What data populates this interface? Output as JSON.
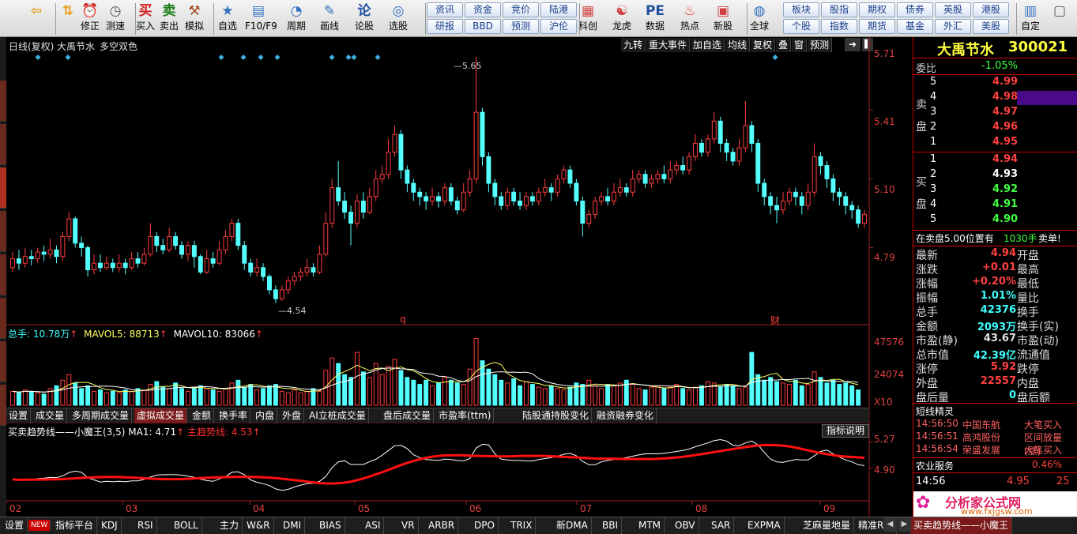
{
  "toolbar": {
    "left": [
      {
        "icon": "back-arrow-icon",
        "label": "",
        "x": 45
      },
      {
        "icon": "up-down-arrow-icon",
        "label": "",
        "x": 85
      },
      {
        "icon": "alarm-icon",
        "label": "修正",
        "x": 113
      },
      {
        "icon": "clock-icon",
        "label": "测速",
        "x": 145
      },
      {
        "icon": "buy-icon",
        "label": "买入",
        "x": 183
      },
      {
        "icon": "sell-icon",
        "label": "卖出",
        "x": 213
      },
      {
        "icon": "hammer-icon",
        "label": "模拟",
        "x": 245
      },
      {
        "icon": "star-icon",
        "label": "自选",
        "x": 287
      },
      {
        "icon": "f10-icon",
        "label": "F10/F9",
        "x": 326
      },
      {
        "icon": "period-icon",
        "label": "周期",
        "x": 374
      },
      {
        "icon": "pen-icon",
        "label": "画线",
        "x": 416
      },
      {
        "icon": "lungu-icon",
        "label": "论股",
        "x": 460
      },
      {
        "icon": "select-stock-icon",
        "label": "选股",
        "x": 503
      }
    ],
    "grid_top": [
      "资讯",
      "资金",
      "竞价",
      "陆港"
    ],
    "grid_bottom": [
      "研报",
      "BBD",
      "预测",
      "沪伦"
    ],
    "mid": [
      {
        "icon": "chart-icon",
        "label": "科创",
        "x": 743
      },
      {
        "icon": "dragon-icon",
        "label": "龙虎",
        "x": 786
      },
      {
        "icon": "pe-icon",
        "label": "数据",
        "x": 828
      },
      {
        "icon": "hot-icon",
        "label": "热点",
        "x": 872
      },
      {
        "icon": "newstock-icon",
        "label": "新股",
        "x": 914
      },
      {
        "icon": "globe-icon",
        "label": "全球",
        "x": 960
      }
    ],
    "grid2_top": [
      "板块",
      "股指",
      "期权",
      "债券",
      "英股",
      "港股"
    ],
    "grid2_bottom": [
      "个股",
      "指数",
      "期货",
      "基金",
      "外汇",
      "美股"
    ],
    "right": [
      {
        "icon": "custom-icon",
        "label": "自定",
        "x": 1303
      },
      {
        "icon": "window-icon",
        "label": "",
        "x": 1340
      }
    ]
  },
  "header": {
    "title": "日线(复权)",
    "stock": "大禹节水",
    "indicator_name": "多空双色",
    "buttons": [
      "九转",
      "重大事件",
      "加自选",
      "均线",
      "复权",
      "叠",
      "窗",
      "预测"
    ]
  },
  "axis": {
    "price_ticks": [
      "5.71",
      "5.41",
      "5.10",
      "4.79"
    ],
    "high_label": "5.65",
    "low_label": "4.54",
    "vol_ticks": [
      "47576",
      "24074",
      "X10"
    ],
    "ind_ticks": [
      "5.27",
      "4.90"
    ],
    "x_labels": [
      "02",
      "03",
      "04",
      "05",
      "06",
      "07",
      "08",
      "09"
    ],
    "q_marker": "q",
    "cai_marker": "财"
  },
  "volume": {
    "label": "总手:",
    "value": "10.78万",
    "arrow": "↑",
    "mavol5_label": "MAVOL5:",
    "mavol5": "88713",
    "mavol10_label": "MAVOL10:",
    "mavol10": "83066"
  },
  "vol_tabs": [
    "设置",
    "成交量",
    "多周期成交量",
    "虚拟成交量",
    "金额",
    "换手率",
    "内盘",
    "外盘",
    "AI立桩成交量",
    "盘后成交量",
    "市盈率(ttm)",
    "陆股通持股变化",
    "融资融券变化"
  ],
  "vol_tab_active": "虚拟成交量",
  "indicator": {
    "name": "买卖趋势线——小魔王(3,5)",
    "ma1_label": "MA1:",
    "ma1": "4.71",
    "arrow": "↑",
    "main_label": "主趋势线:",
    "main": "4.53",
    "help": "指标说明"
  },
  "bottom_tabs": [
    "设置",
    "NEW",
    "指标平台",
    "KDJ",
    "RSI",
    "BOLL",
    "主力",
    "W&R",
    "DMI",
    "BIAS",
    "ASI",
    "VR",
    "ARBR",
    "DPO",
    "TRIX",
    "新DMA",
    "BBI",
    "MTM",
    "OBV",
    "SAR",
    "EXPMA",
    "芝麻量地量",
    "精准RSI",
    "买卖趋势线——小魔王"
  ],
  "quote": {
    "name": "大禹节水",
    "code": "300021",
    "weibi_label": "委比",
    "weibi": "-1.05%",
    "sell_label": "卖盘",
    "buy_label": "买盘",
    "asks": [
      {
        "lvl": "5",
        "price": "4.99",
        "vol": ""
      },
      {
        "lvl": "4",
        "price": "4.98",
        "vol": ""
      },
      {
        "lvl": "3",
        "price": "4.97",
        "vol": ""
      },
      {
        "lvl": "2",
        "price": "4.96",
        "vol": ""
      },
      {
        "lvl": "1",
        "price": "4.95",
        "vol": ""
      }
    ],
    "bids": [
      {
        "lvl": "1",
        "price": "4.94",
        "vol": ""
      },
      {
        "lvl": "2",
        "price": "4.93",
        "vol": ""
      },
      {
        "lvl": "3",
        "price": "4.92",
        "vol": ""
      },
      {
        "lvl": "4",
        "price": "4.91",
        "vol": ""
      },
      {
        "lvl": "5",
        "price": "4.90",
        "vol": ""
      }
    ],
    "note_left": "在卖盘5.00位置有",
    "note_vol": "1030手",
    "note_right": "卖单!",
    "stats": [
      {
        "l": "最新",
        "v": "4.94",
        "r": "开盘",
        "c": "#ff4040"
      },
      {
        "l": "涨跌",
        "v": "+0.01",
        "r": "最高",
        "c": "#ff4040"
      },
      {
        "l": "涨幅",
        "v": "+0.20%",
        "r": "最低",
        "c": "#ff4040"
      },
      {
        "l": "振幅",
        "v": "1.01%",
        "r": "量比",
        "c": "#40ffff"
      },
      {
        "l": "总手",
        "v": "42376",
        "r": "换手",
        "c": "#40ffff"
      },
      {
        "l": "金额",
        "v": "2093万",
        "r": "换手(实)",
        "c": "#40ffff"
      },
      {
        "l": "市盈(静)",
        "v": "43.67",
        "r": "市盈(动)",
        "c": "#e0e0e0"
      },
      {
        "l": "总市值",
        "v": "42.39亿",
        "r": "流通值",
        "c": "#40ffff"
      },
      {
        "l": "涨停",
        "v": "5.92",
        "r": "跌停",
        "c": "#ff4040"
      },
      {
        "l": "外盘",
        "v": "22557",
        "r": "内盘",
        "c": "#ff4040"
      },
      {
        "l": "盘后量",
        "v": "0",
        "r": "盘后额",
        "c": "#40ffff"
      }
    ],
    "jingling_title": "短线精灵",
    "jingling": [
      {
        "t": "14:56:50",
        "name": "中国东航",
        "act": "大笔买入"
      },
      {
        "t": "14:56:51",
        "name": "高鸿股份",
        "act": "区间放量(涨)"
      },
      {
        "t": "14:56:54",
        "name": "荣盛发展",
        "act": "大笔买入"
      }
    ],
    "sector_name": "农业服务",
    "sector_pct": "0.46%",
    "tick_time": "14:56",
    "tick_price": "4.95",
    "tick_vol": "25",
    "logo_text": "分析家公式网",
    "logo_url": "www.fxjgsw.com"
  },
  "chart_data": {
    "type": "candlestick",
    "ylim": [
      4.5,
      5.71
    ],
    "candles": [
      [
        4.7,
        4.74,
        4.77,
        4.68
      ],
      [
        4.74,
        4.72,
        4.78,
        4.69
      ],
      [
        4.72,
        4.75,
        4.79,
        4.7
      ],
      [
        4.75,
        4.74,
        4.78,
        4.71
      ],
      [
        4.74,
        4.77,
        4.79,
        4.72
      ],
      [
        4.77,
        4.76,
        4.8,
        4.73
      ],
      [
        4.76,
        4.78,
        4.83,
        4.74
      ],
      [
        4.78,
        4.75,
        4.8,
        4.72
      ],
      [
        4.75,
        4.84,
        4.86,
        4.73
      ],
      [
        4.84,
        4.92,
        4.95,
        4.82
      ],
      [
        4.92,
        4.81,
        4.93,
        4.79
      ],
      [
        4.81,
        4.79,
        4.84,
        4.75
      ],
      [
        4.79,
        4.69,
        4.8,
        4.66
      ],
      [
        4.69,
        4.72,
        4.76,
        4.67
      ],
      [
        4.72,
        4.7,
        4.76,
        4.68
      ],
      [
        4.7,
        4.72,
        4.75,
        4.69
      ],
      [
        4.72,
        4.7,
        4.74,
        4.68
      ],
      [
        4.7,
        4.72,
        4.76,
        4.68
      ],
      [
        4.72,
        4.7,
        4.74,
        4.67
      ],
      [
        4.7,
        4.74,
        4.77,
        4.69
      ],
      [
        4.74,
        4.72,
        4.77,
        4.7
      ],
      [
        4.72,
        4.76,
        4.79,
        4.71
      ],
      [
        4.76,
        4.84,
        4.9,
        4.75
      ],
      [
        4.84,
        4.8,
        4.86,
        4.77
      ],
      [
        4.8,
        4.78,
        4.83,
        4.76
      ],
      [
        4.78,
        4.84,
        4.88,
        4.77
      ],
      [
        4.84,
        4.8,
        4.86,
        4.78
      ],
      [
        4.8,
        4.76,
        4.82,
        4.74
      ],
      [
        4.76,
        4.8,
        4.82,
        4.73
      ],
      [
        4.8,
        4.75,
        4.82,
        4.7
      ],
      [
        4.75,
        4.68,
        4.76,
        4.67
      ],
      [
        4.68,
        4.74,
        4.78,
        4.67
      ],
      [
        4.74,
        4.72,
        4.77,
        4.7
      ],
      [
        4.72,
        4.78,
        4.82,
        4.71
      ],
      [
        4.78,
        4.84,
        4.87,
        4.76
      ],
      [
        4.84,
        4.9,
        4.92,
        4.82
      ],
      [
        4.9,
        4.8,
        4.92,
        4.78
      ],
      [
        4.8,
        4.72,
        4.82,
        4.69
      ],
      [
        4.72,
        4.68,
        4.74,
        4.66
      ],
      [
        4.68,
        4.7,
        4.74,
        4.66
      ],
      [
        4.7,
        4.66,
        4.72,
        4.64
      ],
      [
        4.66,
        4.6,
        4.67,
        4.58
      ],
      [
        4.6,
        4.56,
        4.62,
        4.54
      ],
      [
        4.56,
        4.6,
        4.62,
        4.55
      ],
      [
        4.6,
        4.64,
        4.66,
        4.58
      ],
      [
        4.64,
        4.66,
        4.68,
        4.62
      ],
      [
        4.66,
        4.68,
        4.7,
        4.64
      ],
      [
        4.68,
        4.7,
        4.74,
        4.66
      ],
      [
        4.7,
        4.68,
        4.72,
        4.66
      ],
      [
        4.68,
        4.76,
        4.8,
        4.67
      ],
      [
        4.76,
        4.9,
        4.95,
        4.75
      ],
      [
        4.9,
        5.06,
        5.1,
        4.88
      ],
      [
        5.06,
        5.0,
        5.18,
        4.98
      ],
      [
        5.0,
        4.95,
        5.04,
        4.92
      ],
      [
        4.95,
        4.9,
        4.98,
        4.8
      ],
      [
        4.9,
        5.0,
        5.03,
        4.88
      ],
      [
        5.0,
        4.95,
        5.04,
        4.92
      ],
      [
        4.95,
        5.02,
        5.06,
        4.94
      ],
      [
        5.02,
        5.1,
        5.14,
        5.0
      ],
      [
        5.1,
        5.12,
        5.16,
        5.08
      ],
      [
        5.12,
        5.22,
        5.28,
        5.1
      ],
      [
        5.22,
        5.3,
        5.34,
        5.2
      ],
      [
        5.3,
        5.14,
        5.32,
        5.1
      ],
      [
        5.14,
        5.08,
        5.16,
        5.04
      ],
      [
        5.08,
        5.04,
        5.1,
        5.0
      ],
      [
        5.04,
        5.02,
        5.06,
        4.98
      ],
      [
        5.02,
        5.0,
        5.04,
        4.96
      ],
      [
        5.0,
        5.02,
        5.06,
        4.98
      ],
      [
        5.02,
        5.0,
        5.04,
        4.97
      ],
      [
        5.0,
        5.06,
        5.08,
        4.98
      ],
      [
        5.06,
        5.0,
        5.08,
        4.98
      ],
      [
        5.0,
        4.96,
        5.02,
        4.94
      ],
      [
        4.96,
        5.04,
        5.08,
        4.95
      ],
      [
        5.04,
        5.1,
        5.14,
        5.02
      ],
      [
        5.1,
        5.4,
        5.65,
        5.08
      ],
      [
        5.4,
        5.2,
        5.42,
        5.16
      ],
      [
        5.2,
        5.08,
        5.22,
        5.04
      ],
      [
        5.08,
        5.02,
        5.1,
        4.98
      ],
      [
        5.02,
        4.98,
        5.04,
        4.96
      ],
      [
        4.98,
        5.04,
        5.06,
        4.96
      ],
      [
        5.04,
        5.0,
        5.06,
        4.98
      ],
      [
        5.0,
        4.98,
        5.04,
        4.96
      ],
      [
        4.98,
        5.02,
        5.04,
        4.96
      ],
      [
        5.02,
        5.0,
        5.04,
        4.98
      ],
      [
        5.0,
        5.04,
        5.06,
        4.98
      ],
      [
        5.04,
        5.06,
        5.1,
        5.02
      ],
      [
        5.06,
        5.04,
        5.08,
        5.0
      ],
      [
        5.04,
        5.1,
        5.12,
        5.02
      ],
      [
        5.1,
        5.14,
        5.16,
        5.08
      ],
      [
        5.14,
        5.08,
        5.16,
        5.06
      ],
      [
        5.08,
        5.0,
        5.1,
        4.98
      ],
      [
        5.0,
        4.9,
        5.02,
        4.84
      ],
      [
        4.9,
        4.94,
        4.96,
        4.88
      ],
      [
        4.94,
        5.0,
        5.02,
        4.92
      ],
      [
        5.0,
        5.02,
        5.04,
        4.98
      ],
      [
        5.02,
        5.0,
        5.06,
        4.98
      ],
      [
        5.0,
        5.04,
        5.08,
        4.98
      ],
      [
        5.04,
        5.06,
        5.1,
        5.02
      ],
      [
        5.06,
        5.04,
        5.08,
        5.02
      ],
      [
        5.04,
        5.1,
        5.14,
        5.02
      ],
      [
        5.1,
        5.12,
        5.14,
        5.08
      ],
      [
        5.12,
        5.08,
        5.14,
        5.06
      ],
      [
        5.08,
        5.1,
        5.12,
        5.06
      ],
      [
        5.1,
        5.12,
        5.14,
        5.08
      ],
      [
        5.12,
        5.1,
        5.16,
        5.08
      ],
      [
        5.1,
        5.14,
        5.18,
        5.08
      ],
      [
        5.14,
        5.16,
        5.18,
        5.12
      ],
      [
        5.16,
        5.14,
        5.2,
        5.12
      ],
      [
        5.14,
        5.2,
        5.22,
        5.12
      ],
      [
        5.2,
        5.26,
        5.3,
        5.18
      ],
      [
        5.26,
        5.22,
        5.28,
        5.2
      ],
      [
        5.22,
        5.28,
        5.3,
        5.2
      ],
      [
        5.28,
        5.36,
        5.4,
        5.26
      ],
      [
        5.36,
        5.26,
        5.38,
        5.22
      ],
      [
        5.26,
        5.22,
        5.28,
        5.18
      ],
      [
        5.22,
        5.18,
        5.24,
        5.16
      ],
      [
        5.18,
        5.24,
        5.28,
        5.16
      ],
      [
        5.24,
        5.34,
        5.45,
        5.22
      ],
      [
        5.34,
        5.26,
        5.36,
        5.22
      ],
      [
        5.26,
        5.08,
        5.28,
        5.04
      ],
      [
        5.08,
        5.02,
        5.1,
        4.98
      ],
      [
        5.02,
        4.98,
        5.04,
        4.94
      ],
      [
        4.98,
        4.96,
        5.02,
        4.9
      ],
      [
        4.96,
        5.0,
        5.04,
        4.94
      ],
      [
        5.0,
        5.04,
        5.06,
        4.98
      ],
      [
        5.04,
        5.02,
        5.06,
        4.98
      ],
      [
        5.02,
        4.98,
        5.04,
        4.94
      ],
      [
        4.98,
        5.04,
        5.08,
        4.96
      ],
      [
        5.04,
        5.2,
        5.26,
        5.02
      ],
      [
        5.2,
        5.16,
        5.22,
        5.12
      ],
      [
        5.16,
        5.1,
        5.18,
        5.06
      ],
      [
        5.1,
        5.04,
        5.12,
        5.0
      ],
      [
        5.04,
        5.02,
        5.06,
        4.98
      ],
      [
        5.02,
        4.98,
        5.04,
        4.94
      ],
      [
        4.98,
        4.96,
        5.0,
        4.92
      ],
      [
        4.96,
        4.9,
        4.98,
        4.88
      ],
      [
        4.9,
        4.94,
        4.96,
        4.88
      ]
    ],
    "volume": [
      10,
      9,
      11,
      10,
      9,
      8,
      12,
      14,
      18,
      22,
      16,
      12,
      14,
      10,
      11,
      9,
      10,
      9,
      11,
      10,
      12,
      11,
      15,
      17,
      13,
      12,
      16,
      12,
      10,
      13,
      14,
      12,
      11,
      10,
      12,
      16,
      18,
      13,
      15,
      11,
      12,
      14,
      15,
      10,
      9,
      11,
      9,
      10,
      12,
      10,
      25,
      34,
      30,
      22,
      20,
      38,
      24,
      20,
      30,
      22,
      28,
      33,
      25,
      20,
      18,
      15,
      18,
      14,
      16,
      20,
      18,
      16,
      15,
      26,
      48,
      32,
      26,
      22,
      18,
      16,
      19,
      14,
      17,
      15,
      13,
      12,
      14,
      12,
      11,
      13,
      16,
      15,
      18,
      14,
      12,
      15,
      14,
      16,
      18,
      15,
      12,
      11,
      13,
      14,
      12,
      13,
      15,
      12,
      11,
      13,
      14,
      17,
      16,
      13,
      15,
      14,
      12,
      13,
      38,
      22,
      18,
      20,
      17,
      16,
      15,
      18,
      14,
      15,
      24,
      20,
      16,
      18,
      15,
      16,
      14,
      11
    ],
    "indicator_series": [
      "MA1",
      "主趋势线"
    ]
  }
}
